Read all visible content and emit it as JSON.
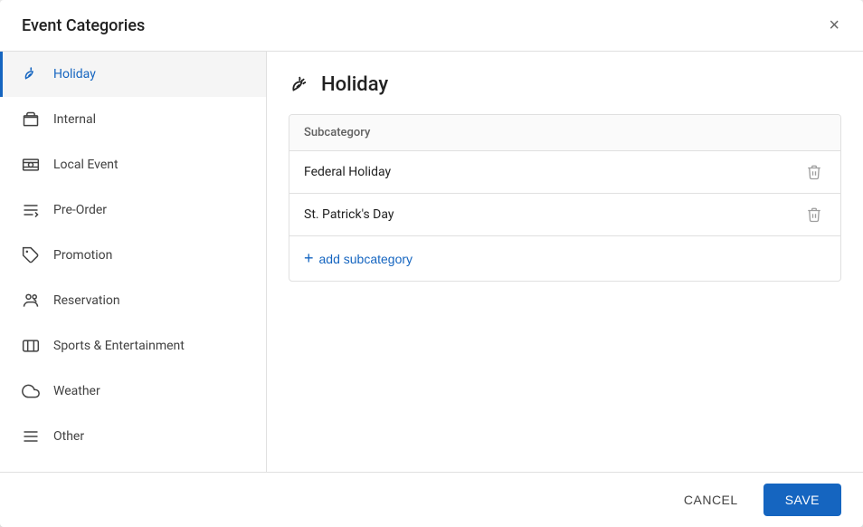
{
  "dialog": {
    "title": "Event Categories",
    "close_label": "×"
  },
  "sidebar": {
    "items": [
      {
        "id": "holiday",
        "label": "Holiday",
        "active": true,
        "icon": "party-icon"
      },
      {
        "id": "internal",
        "label": "Internal",
        "active": false,
        "icon": "internal-icon"
      },
      {
        "id": "local-event",
        "label": "Local Event",
        "active": false,
        "icon": "local-event-icon"
      },
      {
        "id": "pre-order",
        "label": "Pre-Order",
        "active": false,
        "icon": "pre-order-icon"
      },
      {
        "id": "promotion",
        "label": "Promotion",
        "active": false,
        "icon": "promotion-icon"
      },
      {
        "id": "reservation",
        "label": "Reservation",
        "active": false,
        "icon": "reservation-icon"
      },
      {
        "id": "sports",
        "label": "Sports & Entertainment",
        "active": false,
        "icon": "sports-icon"
      },
      {
        "id": "weather",
        "label": "Weather",
        "active": false,
        "icon": "weather-icon"
      },
      {
        "id": "other",
        "label": "Other",
        "active": false,
        "icon": "other-icon"
      }
    ]
  },
  "main": {
    "category_title": "Holiday",
    "subcategory_header": "Subcategory",
    "subcategories": [
      {
        "name": "Federal Holiday"
      },
      {
        "name": "St. Patrick's Day"
      }
    ],
    "add_label": "add subcategory"
  },
  "footer": {
    "cancel_label": "CANCEL",
    "save_label": "SAVE"
  }
}
